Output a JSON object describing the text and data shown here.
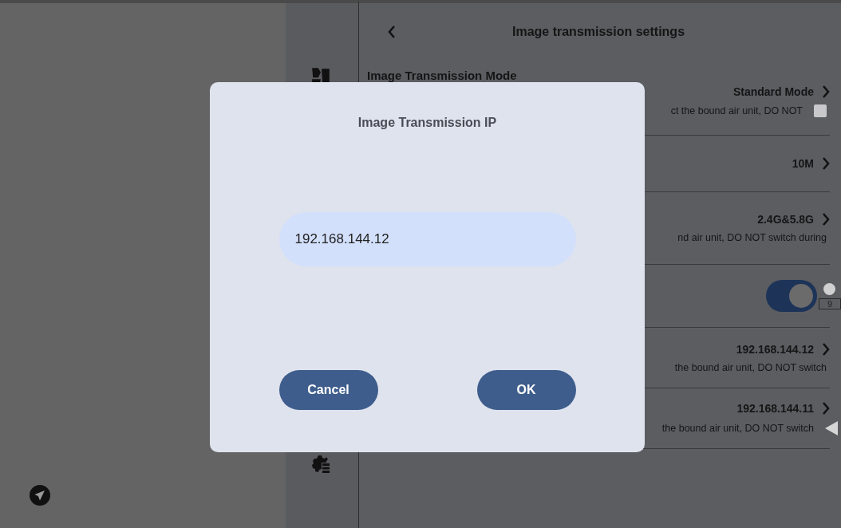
{
  "header": {
    "title": "Image transmission settings"
  },
  "rows": [
    {
      "kind": "select",
      "title": "Image Transmission Mode",
      "value": "Standard Mode",
      "description": "ct the bound air unit, DO NOT",
      "checked": false
    },
    {
      "kind": "select",
      "value": "10M"
    },
    {
      "kind": "select",
      "value": "2.4G&5.8G",
      "description": "nd air unit, DO NOT switch during"
    },
    {
      "kind": "toggle",
      "on": true,
      "counter": "9"
    },
    {
      "kind": "select",
      "value": "192.168.144.12",
      "description": "the bound air unit, DO NOT switch"
    },
    {
      "kind": "select",
      "value": "192.168.144.11",
      "description": "the bound air unit, DO NOT switch"
    }
  ],
  "dialog": {
    "title": "Image Transmission IP",
    "value": "192.168.144.12",
    "buttons": [
      "Cancel",
      "OK"
    ]
  }
}
